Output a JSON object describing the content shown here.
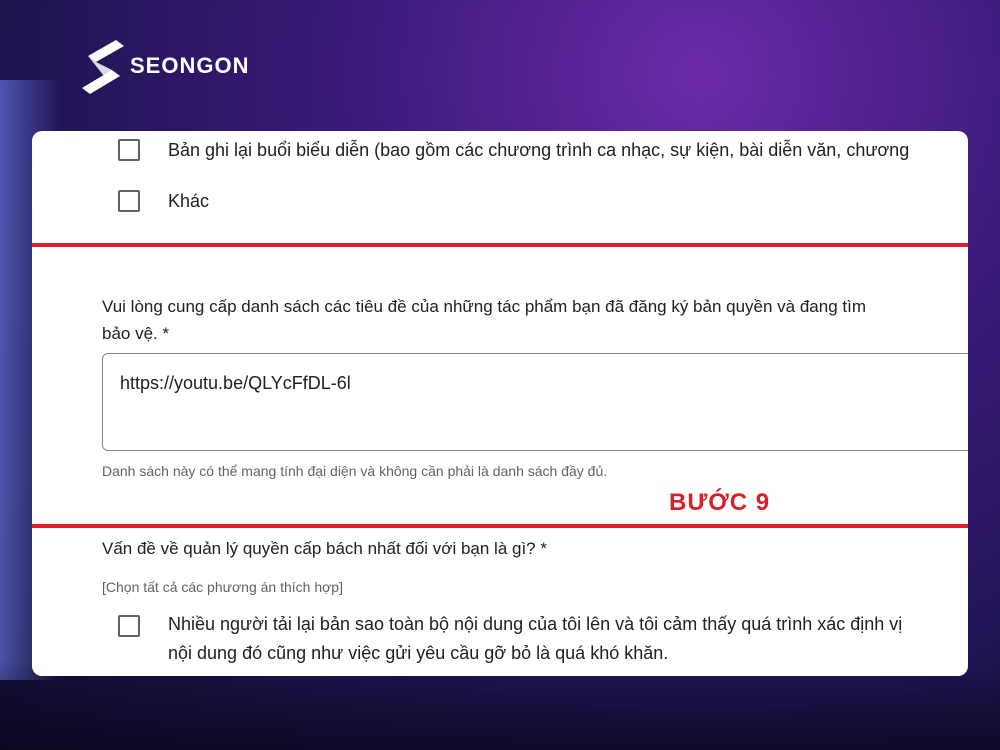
{
  "brand": {
    "name": "SEONGON"
  },
  "form": {
    "options_top": [
      {
        "label": "Bản ghi lại buổi biểu diễn (bao gồm các chương trình ca nhạc, sự kiện, bài diễn văn, chương"
      },
      {
        "label": "Khác"
      }
    ],
    "question1": {
      "text": "Vui lòng cung cấp danh sách các tiêu đề của những tác phẩm bạn đã đăng ký bản quyền và đang tìm",
      "text_line2": "bảo vệ. *",
      "answer_value": "https://youtu.be/QLYcFfDL-6l",
      "helper": "Danh sách này có thể mang tính đại diện và không cần phải là danh sách đầy đủ."
    },
    "step_label": "BƯỚC 9",
    "question2": {
      "text": "Vấn đề về quản lý quyền cấp bách nhất đối với bạn là gì? *",
      "hint": "[Chọn tất cả các phương án thích hợp]",
      "option1_line1": "Nhiều người tải lại bản sao toàn bộ nội dung của tôi lên và tôi cảm thấy quá trình xác định vị",
      "option1_line2": "nội dung đó cũng như việc gửi yêu cầu gỡ bỏ là quá khó khăn."
    }
  },
  "colors": {
    "accent_red": "#e0202a",
    "step_red": "#d81f2a",
    "bg_purple": "#3a1a7a"
  }
}
